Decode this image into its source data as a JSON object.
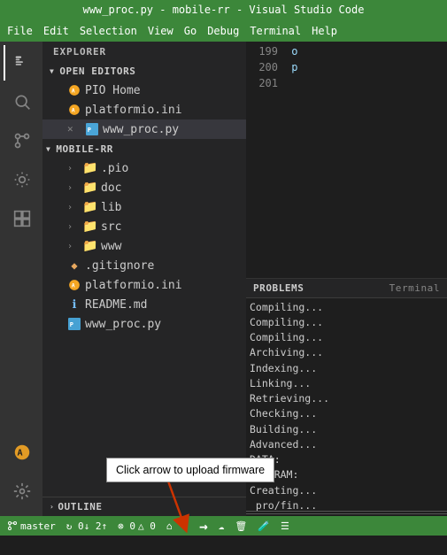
{
  "titleBar": {
    "text": "www_proc.py - mobile-rr - Visual Studio Code"
  },
  "menuBar": {
    "items": [
      "File",
      "Edit",
      "Selection",
      "View",
      "Go",
      "Debug",
      "Terminal",
      "Help"
    ]
  },
  "activityBar": {
    "icons": [
      {
        "name": "explorer-icon",
        "glyph": "⧉",
        "active": true
      },
      {
        "name": "search-icon",
        "glyph": "🔍",
        "active": false
      },
      {
        "name": "source-control-icon",
        "glyph": "⑃",
        "active": false
      },
      {
        "name": "debug-icon",
        "glyph": "🐛",
        "active": false
      },
      {
        "name": "extensions-icon",
        "glyph": "⊞",
        "active": false
      }
    ],
    "bottomIcons": [
      {
        "name": "pio-icon",
        "glyph": "🐞"
      },
      {
        "name": "settings-icon",
        "glyph": "⚙"
      }
    ]
  },
  "sidebar": {
    "title": "EXPLORER",
    "sections": {
      "openEditors": {
        "label": "OPEN EDITORS",
        "items": [
          {
            "label": "PIO Home",
            "icon": "pio",
            "indent": 1
          },
          {
            "label": "platformio.ini",
            "icon": "ini",
            "indent": 1
          },
          {
            "label": "www_proc.py",
            "icon": "py",
            "indent": 1,
            "active": true,
            "hasClose": true
          }
        ]
      },
      "mobileRR": {
        "label": "MOBILE-RR",
        "items": [
          {
            "label": ".pio",
            "icon": "folder",
            "indent": 1,
            "hasChevron": true
          },
          {
            "label": "doc",
            "icon": "folder",
            "indent": 1,
            "hasChevron": true
          },
          {
            "label": "lib",
            "icon": "folder",
            "indent": 1,
            "hasChevron": true
          },
          {
            "label": "src",
            "icon": "folder",
            "indent": 1,
            "hasChevron": true
          },
          {
            "label": "www",
            "icon": "folder",
            "indent": 1,
            "hasChevron": true
          },
          {
            "label": ".gitignore",
            "icon": "gitignore",
            "indent": 1
          },
          {
            "label": "platformio.ini",
            "icon": "ini",
            "indent": 1
          },
          {
            "label": "README.md",
            "icon": "info",
            "indent": 1
          },
          {
            "label": "www_proc.py",
            "icon": "py",
            "indent": 1
          }
        ]
      }
    },
    "outline": "OUTLINE"
  },
  "editor": {
    "lines": [
      {
        "num": "199",
        "text": "o"
      },
      {
        "num": "200",
        "text": "p"
      },
      {
        "num": "201",
        "text": ""
      }
    ],
    "panelTitle": "PROBLEMS",
    "terminalLabel": "Terminal",
    "output": [
      "Compiling...",
      "Compiling...",
      "Compiling...",
      "Archiving...",
      "Indexing...",
      "Linking...",
      "Retrieving...",
      "Checking...",
      "Building...",
      "Advanced...",
      "DATA:",
      "PROGRAM:",
      "Creating...",
      "_pro/fin..."
    ]
  },
  "annotation": {
    "text": "Click arrow to upload firmware"
  },
  "statusBar": {
    "branch": "master",
    "sync": "↻ 0↓ 2↑",
    "errors": "⊗ 0",
    "warnings": "△ 0",
    "homeIcon": "⌂",
    "checkIcon": "✓",
    "arrowIcon": "→",
    "cloudIcon": "☁",
    "trashIcon": "🗑",
    "testIcon": "🧪",
    "listIcon": "☰"
  }
}
